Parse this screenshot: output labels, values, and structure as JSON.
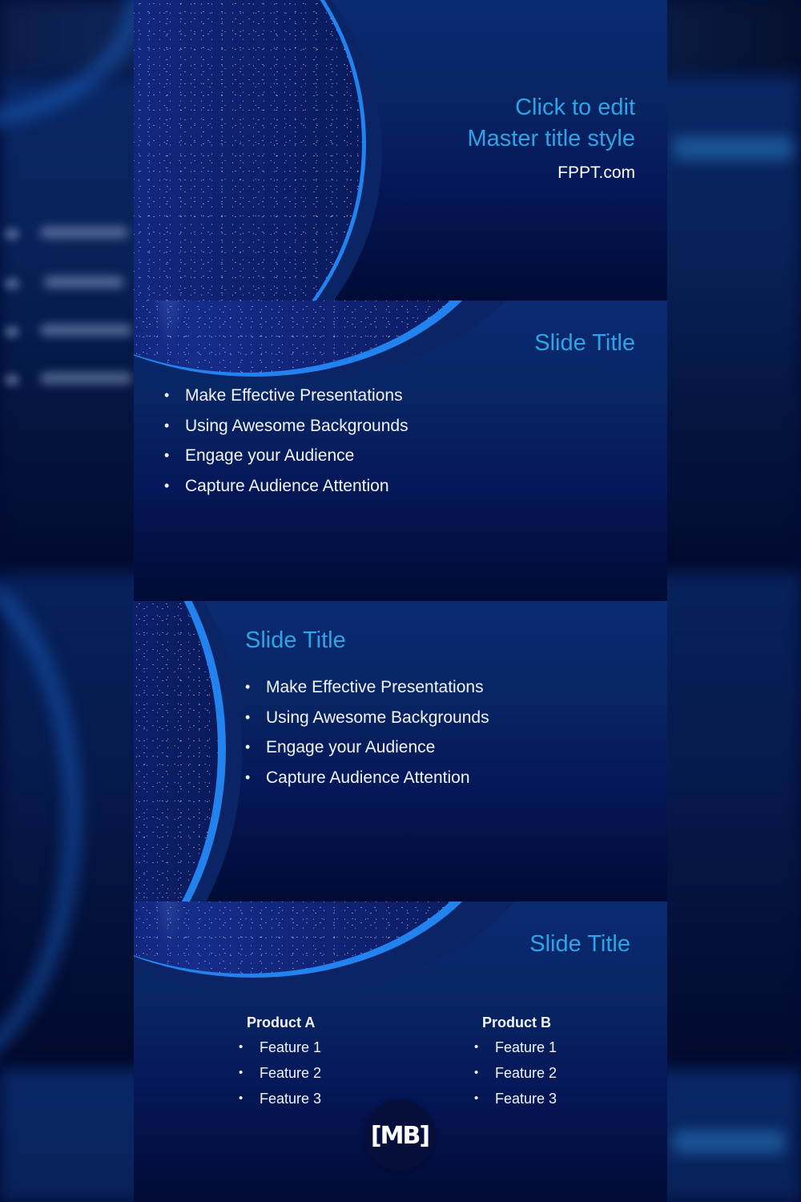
{
  "colors": {
    "title": "#2ea4e6",
    "body_text": "#f2f5ff",
    "accent_arc": "#1f7fe8",
    "background_top": "#0a2a72",
    "background_bottom": "#020b36",
    "logo_bg": "#060f3c"
  },
  "slides": [
    {
      "layout": "title",
      "title_line1": "Click to edit",
      "title_line2": "Master title style",
      "subtitle": "FPPT.com"
    },
    {
      "layout": "title-and-content-top-arc",
      "title": "Slide Title",
      "bullets": [
        "Make Effective Presentations",
        "Using Awesome Backgrounds",
        "Engage your Audience",
        "Capture Audience Attention"
      ]
    },
    {
      "layout": "title-and-content-left-arc",
      "title": "Slide Title",
      "bullets": [
        "Make Effective Presentations",
        "Using Awesome Backgrounds",
        "Engage your Audience",
        "Capture Audience Attention"
      ]
    },
    {
      "layout": "comparison",
      "title": "Slide Title",
      "columns": [
        {
          "heading": "Product A",
          "items": [
            "Feature 1",
            "Feature 2",
            "Feature 3"
          ]
        },
        {
          "heading": "Product B",
          "items": [
            "Feature 1",
            "Feature 2",
            "Feature 3"
          ]
        }
      ]
    }
  ],
  "bullet_glyph": "•",
  "watermark": {
    "icon": "mb-logo-icon",
    "text": "[MB]"
  }
}
